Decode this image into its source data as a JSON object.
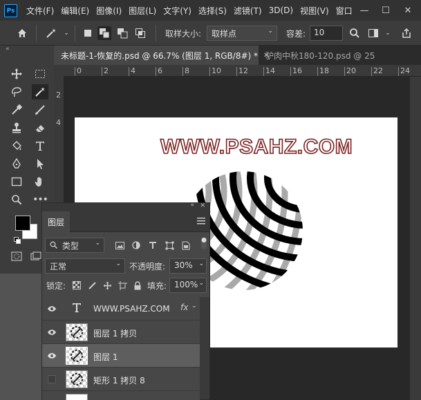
{
  "app": {
    "logo": "Ps"
  },
  "menu": [
    "文件(F)",
    "编辑(E)",
    "图像(I)",
    "图层(L)",
    "文字(Y)",
    "选择(S)",
    "滤镜(T)",
    "3D(D)",
    "视图(V)",
    "窗口"
  ],
  "window_controls": {
    "minimize": "—",
    "maximize": "☐",
    "close": "✕"
  },
  "options_bar": {
    "sample_size_label": "取样大小:",
    "sample_size_value": "取样点",
    "tolerance_label": "容差:",
    "tolerance_value": "10"
  },
  "tabs": [
    {
      "label": "未标题-1-恢复的.psd @ 66.7% (图层 1, RGB/8#) *",
      "close": "✕",
      "active": true
    },
    {
      "label": "驴肉中秋180-120.psd @ 25",
      "active": false
    }
  ],
  "ruler_h": [
    "0",
    "2",
    "4",
    "6",
    "8",
    "10",
    "12",
    "14",
    "16",
    "18",
    "20",
    "22",
    "24"
  ],
  "ruler_v": [
    "2",
    "4"
  ],
  "canvas": {
    "watermark_text": "WWW.PSAHZ.COM"
  },
  "colors": {
    "foreground": "#000000",
    "background": "#ffffff",
    "watermark_stroke": "#7a1f1f"
  },
  "layers_panel": {
    "title": "图层",
    "filter_label": "类型",
    "blend_mode": "正常",
    "opacity_label": "不透明度:",
    "opacity_value": "30%",
    "lock_label": "锁定:",
    "fill_label": "填充:",
    "fill_value": "100%",
    "layers": [
      {
        "name": "WWW.PSAHZ.COM",
        "type": "text",
        "visible": true,
        "selected": false,
        "fx": "fx"
      },
      {
        "name": "图层 1 拷贝",
        "type": "pixel",
        "visible": true,
        "selected": false
      },
      {
        "name": "图层 1",
        "type": "pixel",
        "visible": true,
        "selected": true
      },
      {
        "name": "矩形 1 拷贝 8",
        "type": "pixel",
        "visible": false,
        "selected": false
      }
    ]
  }
}
